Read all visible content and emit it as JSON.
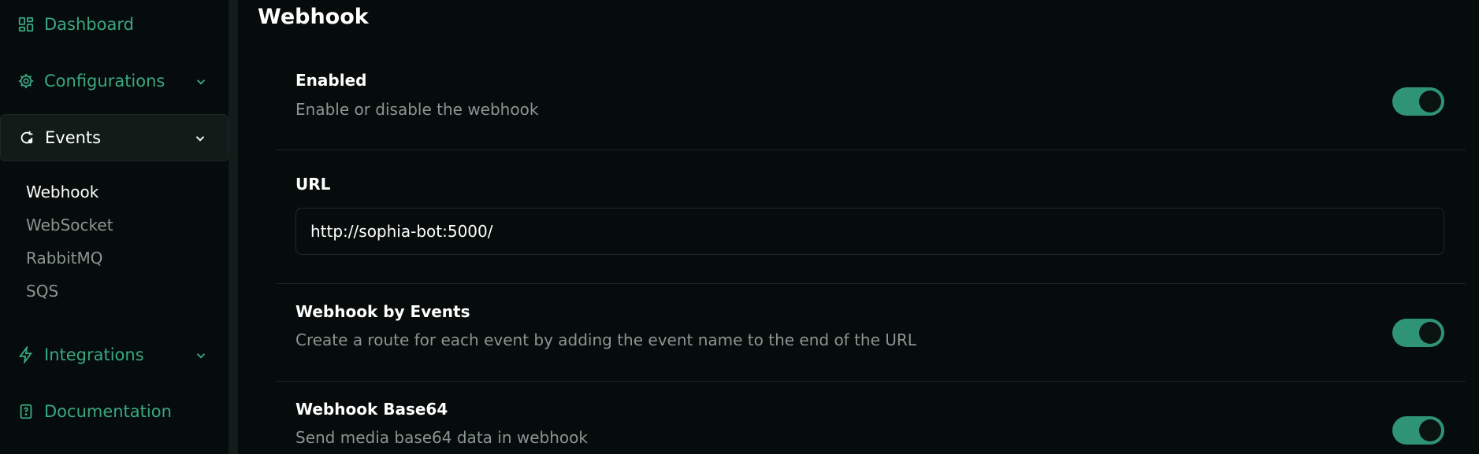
{
  "sidebar": {
    "items": [
      {
        "label": "Dashboard",
        "icon": "dashboard-icon"
      },
      {
        "label": "Configurations",
        "icon": "gear-icon"
      },
      {
        "label": "Events",
        "icon": "events-icon"
      },
      {
        "label": "Integrations",
        "icon": "lightning-icon"
      },
      {
        "label": "Documentation",
        "icon": "document-icon"
      }
    ],
    "events_sub": [
      "Webhook",
      "WebSocket",
      "RabbitMQ",
      "SQS"
    ]
  },
  "main": {
    "title": "Webhook",
    "enabled": {
      "title": "Enabled",
      "desc": "Enable or disable the webhook",
      "value": true
    },
    "url": {
      "label": "URL",
      "value": "http://sophia-bot:5000/"
    },
    "by_events": {
      "title": "Webhook by Events",
      "desc": "Create a route for each event by adding the event name to the end of the URL",
      "value": true
    },
    "base64": {
      "title": "Webhook Base64",
      "desc": "Send media base64 data in webhook",
      "value": true
    }
  },
  "colors": {
    "accent": "#3aa783",
    "toggle_on": "#2f9476",
    "background": "#060c0b"
  }
}
